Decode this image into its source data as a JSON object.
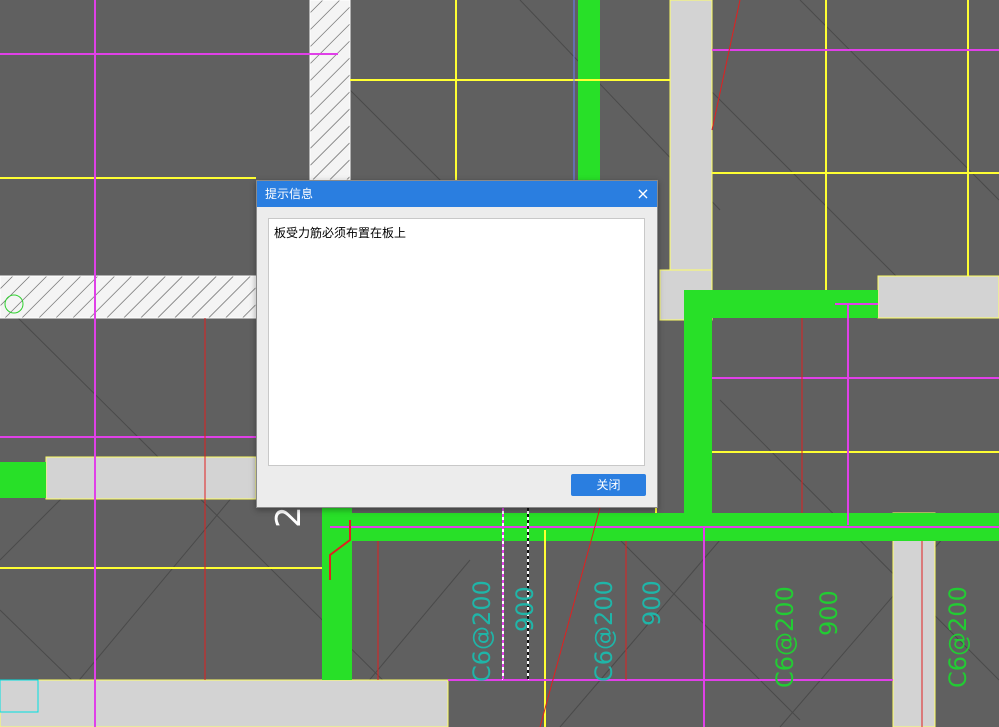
{
  "canvas": {
    "background_color": "#606060",
    "annotations": [
      {
        "text": "C6@200",
        "color": "#1fb5a8"
      },
      {
        "text": "C6@200",
        "color": "#1fb5a8"
      },
      {
        "text": "C6@200",
        "color": "#22cc33"
      },
      {
        "text": "C6@200",
        "color": "#22cc33"
      },
      {
        "text": "900",
        "color": "#1fb5a8"
      },
      {
        "text": "900",
        "color": "#22cc33"
      },
      {
        "text": "900",
        "color": "#1fb5a8"
      },
      {
        "text": "2",
        "color": "#ffffff"
      }
    ]
  },
  "dialog": {
    "title": "提示信息",
    "close_glyph": "×",
    "message": "板受力筋必须布置在板上",
    "close_button_label": "关闭",
    "accent_color": "#2a7ee0"
  }
}
